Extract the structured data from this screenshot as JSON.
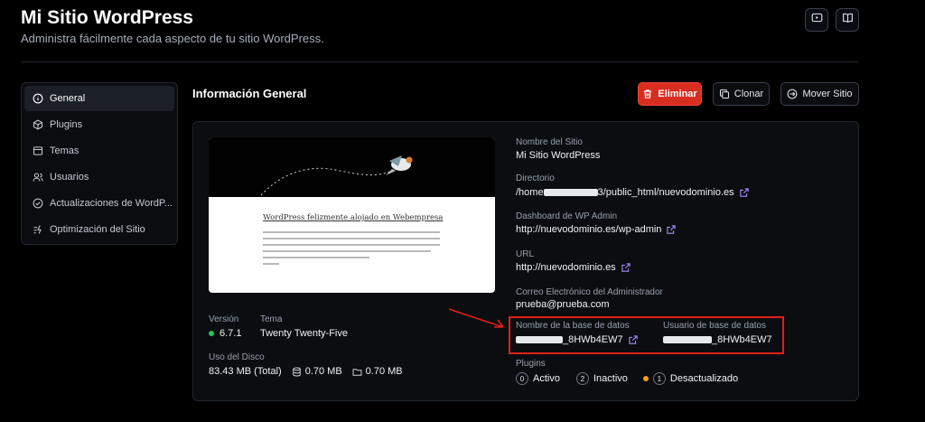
{
  "header": {
    "title": "Mi Sitio WordPress",
    "subtitle": "Administra fácilmente cada aspecto de tu sitio WordPress.",
    "video_icon": "video-icon",
    "book_icon": "book-icon"
  },
  "sidebar": {
    "items": [
      {
        "label": "General",
        "icon": "info-icon"
      },
      {
        "label": "Plugins",
        "icon": "cube-icon"
      },
      {
        "label": "Temas",
        "icon": "palette-icon"
      },
      {
        "label": "Usuarios",
        "icon": "users-icon"
      },
      {
        "label": "Actualizaciones de WordP...",
        "icon": "check-circle-icon"
      },
      {
        "label": "Optimización del Sitio",
        "icon": "bolt-icon"
      }
    ]
  },
  "main": {
    "title": "Información General",
    "actions": {
      "delete_label": "Eliminar",
      "clone_label": "Clonar",
      "move_label": "Mover Sitio"
    }
  },
  "preview": {
    "heading": "WordPress felizmente alojado en Webempresa"
  },
  "site": {
    "version_label": "Versión",
    "version_value": "6.7.1",
    "theme_label": "Tema",
    "theme_value": "Twenty Twenty-Five",
    "disk_label": "Uso del Disco",
    "disk_total": "83.43 MB (Total)",
    "disk_db": "0.70 MB",
    "disk_files": "0.70 MB",
    "name_label": "Nombre del Sitio",
    "name_value": "Mi Sitio WordPress",
    "dir_label": "Directorio",
    "dir_prefix": "/home",
    "dir_suffix": "3/public_html/nuevodominio.es",
    "admin_label": "Dashboard de WP Admin",
    "admin_value": "http://nuevodominio.es/wp-admin",
    "url_label": "URL",
    "url_value": "http://nuevodominio.es",
    "email_label": "Correo Electrónico del Administrador",
    "email_value": "prueba@prueba.com",
    "dbname_label": "Nombre de la base de datos",
    "dbname_suffix": "_8HWb4EW7",
    "dbuser_label": "Usuario de base de datos",
    "dbuser_suffix": "_8HWb4EW7",
    "plugins_label": "Plugins",
    "plugins_active_count": "0",
    "plugins_active_label": "Activo",
    "plugins_inactive_count": "2",
    "plugins_inactive_label": "Inactivo",
    "plugins_outdated_count": "1",
    "plugins_outdated_label": "Desactualizado"
  },
  "colors": {
    "accent_red": "#d92d20",
    "link_icon": "#a78bfa",
    "status_green": "#22c55e",
    "status_orange": "#f59e0b",
    "annotation_red": "#e02018"
  }
}
